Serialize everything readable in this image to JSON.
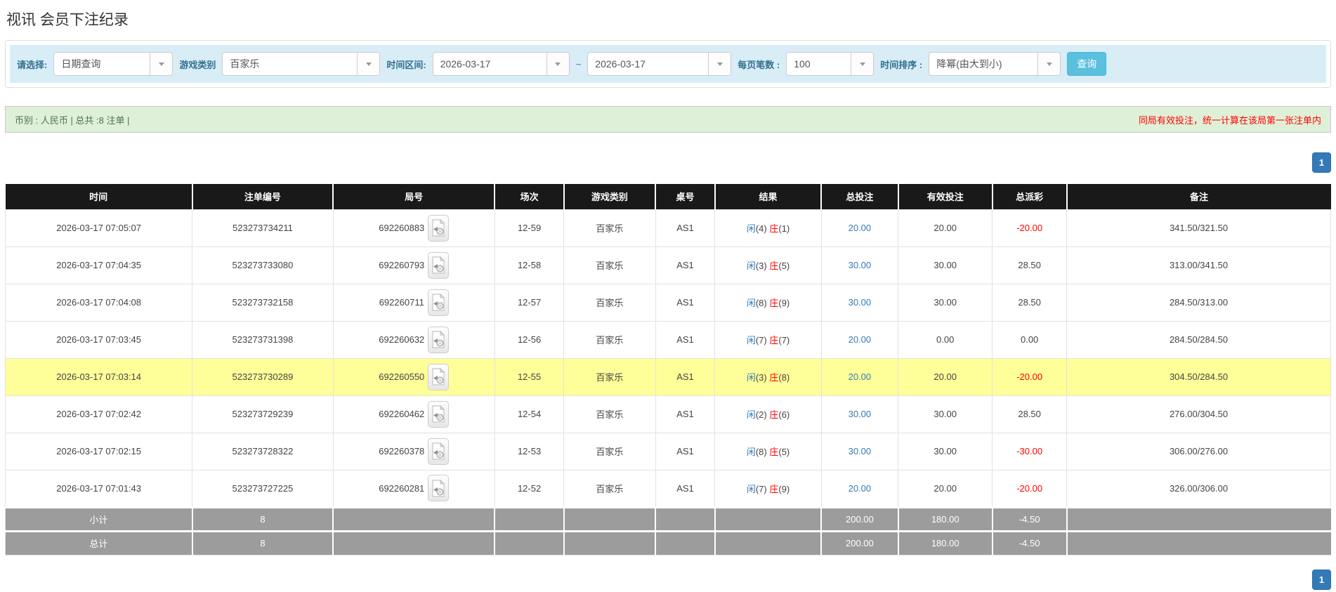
{
  "page": {
    "title": "视讯 会员下注纪录"
  },
  "filters": {
    "select_label": "请选择:",
    "select_value": "日期查询",
    "game_type_label": "游戏类别",
    "game_type_value": "百家乐",
    "time_range_label": "时间区间:",
    "time_from": "2026-03-17",
    "tilde": "~",
    "time_to": "2026-03-17",
    "page_size_label": "每页笔数 :",
    "page_size_value": "100",
    "sort_label": "时间排序 :",
    "sort_value": "降幂(由大到小)",
    "search_button": "查询"
  },
  "info_bar": {
    "left_text": "币别 : 人民币 | 总共 :8 注单 |",
    "right_text": "同局有效投注，统一计算在该局第一张注单内"
  },
  "pagination": {
    "page": "1"
  },
  "table": {
    "headers": [
      "时间",
      "注单编号",
      "局号",
      "场次",
      "游戏类别",
      "桌号",
      "结果",
      "总投注",
      "有效投注",
      "总派彩",
      "备注"
    ],
    "col_widths": [
      "14.1%",
      "10.6%",
      "12.2%",
      "5.2%",
      "6.9%",
      "4.5%",
      "8.0%",
      "5.8%",
      "7.1%",
      "5.6%",
      "19.9%"
    ],
    "video_icon_name": "video-file-icon",
    "rows": [
      {
        "time": "2026-03-17 07:05:07",
        "bet_id": "523273734211",
        "round_id": "692260883",
        "session": "12-59",
        "game": "百家乐",
        "table_no": "AS1",
        "result_player": "闲(4)",
        "result_banker": "庄(1)",
        "total_bet": "20.00",
        "valid_bet": "20.00",
        "payout": "-20.00",
        "remark": "341.50/321.50",
        "highlight": false
      },
      {
        "time": "2026-03-17 07:04:35",
        "bet_id": "523273733080",
        "round_id": "692260793",
        "session": "12-58",
        "game": "百家乐",
        "table_no": "AS1",
        "result_player": "闲(3)",
        "result_banker": "庄(5)",
        "total_bet": "30.00",
        "valid_bet": "30.00",
        "payout": "28.50",
        "remark": "313.00/341.50",
        "highlight": false
      },
      {
        "time": "2026-03-17 07:04:08",
        "bet_id": "523273732158",
        "round_id": "692260711",
        "session": "12-57",
        "game": "百家乐",
        "table_no": "AS1",
        "result_player": "闲(8)",
        "result_banker": "庄(9)",
        "total_bet": "30.00",
        "valid_bet": "30.00",
        "payout": "28.50",
        "remark": "284.50/313.00",
        "highlight": false
      },
      {
        "time": "2026-03-17 07:03:45",
        "bet_id": "523273731398",
        "round_id": "692260632",
        "session": "12-56",
        "game": "百家乐",
        "table_no": "AS1",
        "result_player": "闲(7)",
        "result_banker": "庄(7)",
        "total_bet": "20.00",
        "valid_bet": "0.00",
        "payout": "0.00",
        "remark": "284.50/284.50",
        "highlight": false
      },
      {
        "time": "2026-03-17 07:03:14",
        "bet_id": "523273730289",
        "round_id": "692260550",
        "session": "12-55",
        "game": "百家乐",
        "table_no": "AS1",
        "result_player": "闲(3)",
        "result_banker": "庄(8)",
        "total_bet": "20.00",
        "valid_bet": "20.00",
        "payout": "-20.00",
        "remark": "304.50/284.50",
        "highlight": true
      },
      {
        "time": "2026-03-17 07:02:42",
        "bet_id": "523273729239",
        "round_id": "692260462",
        "session": "12-54",
        "game": "百家乐",
        "table_no": "AS1",
        "result_player": "闲(2)",
        "result_banker": "庄(6)",
        "total_bet": "30.00",
        "valid_bet": "30.00",
        "payout": "28.50",
        "remark": "276.00/304.50",
        "highlight": false
      },
      {
        "time": "2026-03-17 07:02:15",
        "bet_id": "523273728322",
        "round_id": "692260378",
        "session": "12-53",
        "game": "百家乐",
        "table_no": "AS1",
        "result_player": "闲(8)",
        "result_banker": "庄(5)",
        "total_bet": "30.00",
        "valid_bet": "30.00",
        "payout": "-30.00",
        "remark": "306.00/276.00",
        "highlight": false
      },
      {
        "time": "2026-03-17 07:01:43",
        "bet_id": "523273727225",
        "round_id": "692260281",
        "session": "12-52",
        "game": "百家乐",
        "table_no": "AS1",
        "result_player": "闲(7)",
        "result_banker": "庄(9)",
        "total_bet": "20.00",
        "valid_bet": "20.00",
        "payout": "-20.00",
        "remark": "326.00/306.00",
        "highlight": false
      }
    ],
    "subtotal": {
      "label": "小计",
      "count": "8",
      "total_bet": "200.00",
      "valid_bet": "180.00",
      "payout": "-4.50"
    },
    "total": {
      "label": "总计",
      "count": "8",
      "total_bet": "200.00",
      "valid_bet": "180.00",
      "payout": "-4.50"
    }
  },
  "colors": {
    "accent_blue": "#337ab7",
    "negative_red": "#ff0000",
    "player_blue": "#337ab7",
    "banker_red": "#ff0000",
    "filter_bar_bg": "#d9edf7",
    "filter_label": "#31708f",
    "search_button_bg": "#5bc0de",
    "info_bar_bg": "#dff0d8",
    "header_bg": "#191919",
    "highlight_yellow": "#ffff99",
    "summary_gray": "#9c9c9c"
  }
}
